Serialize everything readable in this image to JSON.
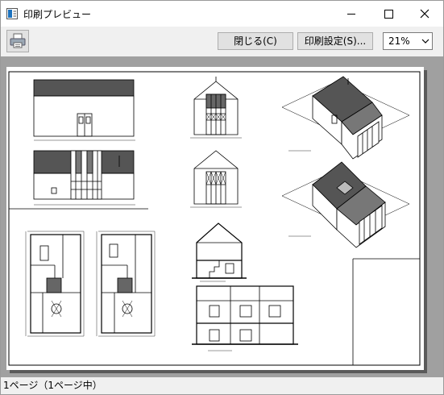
{
  "window": {
    "title": "印刷プレビュー"
  },
  "toolbar": {
    "close_label": "閉じる(C)",
    "print_setup_label": "印刷設定(S)...",
    "zoom": {
      "value": "21%"
    }
  },
  "status": {
    "text": "1ページ（1ページ中）"
  },
  "icons": {
    "app": "print-preview-icon",
    "print": "printer-icon",
    "minimize": "minimize-icon",
    "maximize": "maximize-icon",
    "close": "close-icon",
    "dropdown": "chevron-down-icon"
  }
}
